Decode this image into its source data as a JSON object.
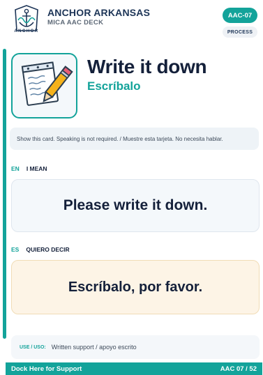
{
  "header": {
    "logo_word": "ANCHOR",
    "brand": "ANCHOR ARKANSAS",
    "deck": "MICA AAC DECK",
    "code": "AAC-07",
    "category": "PROCESS"
  },
  "hero": {
    "icon": "notepad-pencil-icon",
    "title_en": "Write it down",
    "title_es": "Escríbalo"
  },
  "instruction": "Show this card. Speaking is not required. / Muestre esta tarjeta. No necesita hablar.",
  "english": {
    "code": "EN",
    "label": "I MEAN",
    "phrase": "Please write it down."
  },
  "spanish": {
    "code": "ES",
    "label": "QUIERO DECIR",
    "phrase": "Escríbalo, por favor."
  },
  "use": {
    "label": "USE / USO:",
    "text": "Written support / apoyo escrito"
  },
  "footer": {
    "left": "Dock Here for Support",
    "right": "AAC 07 / 52"
  },
  "colors": {
    "accent": "#13a39a",
    "navy": "#14203a",
    "english_box": "#f4f8fb",
    "spanish_box": "#fdf4e6"
  }
}
